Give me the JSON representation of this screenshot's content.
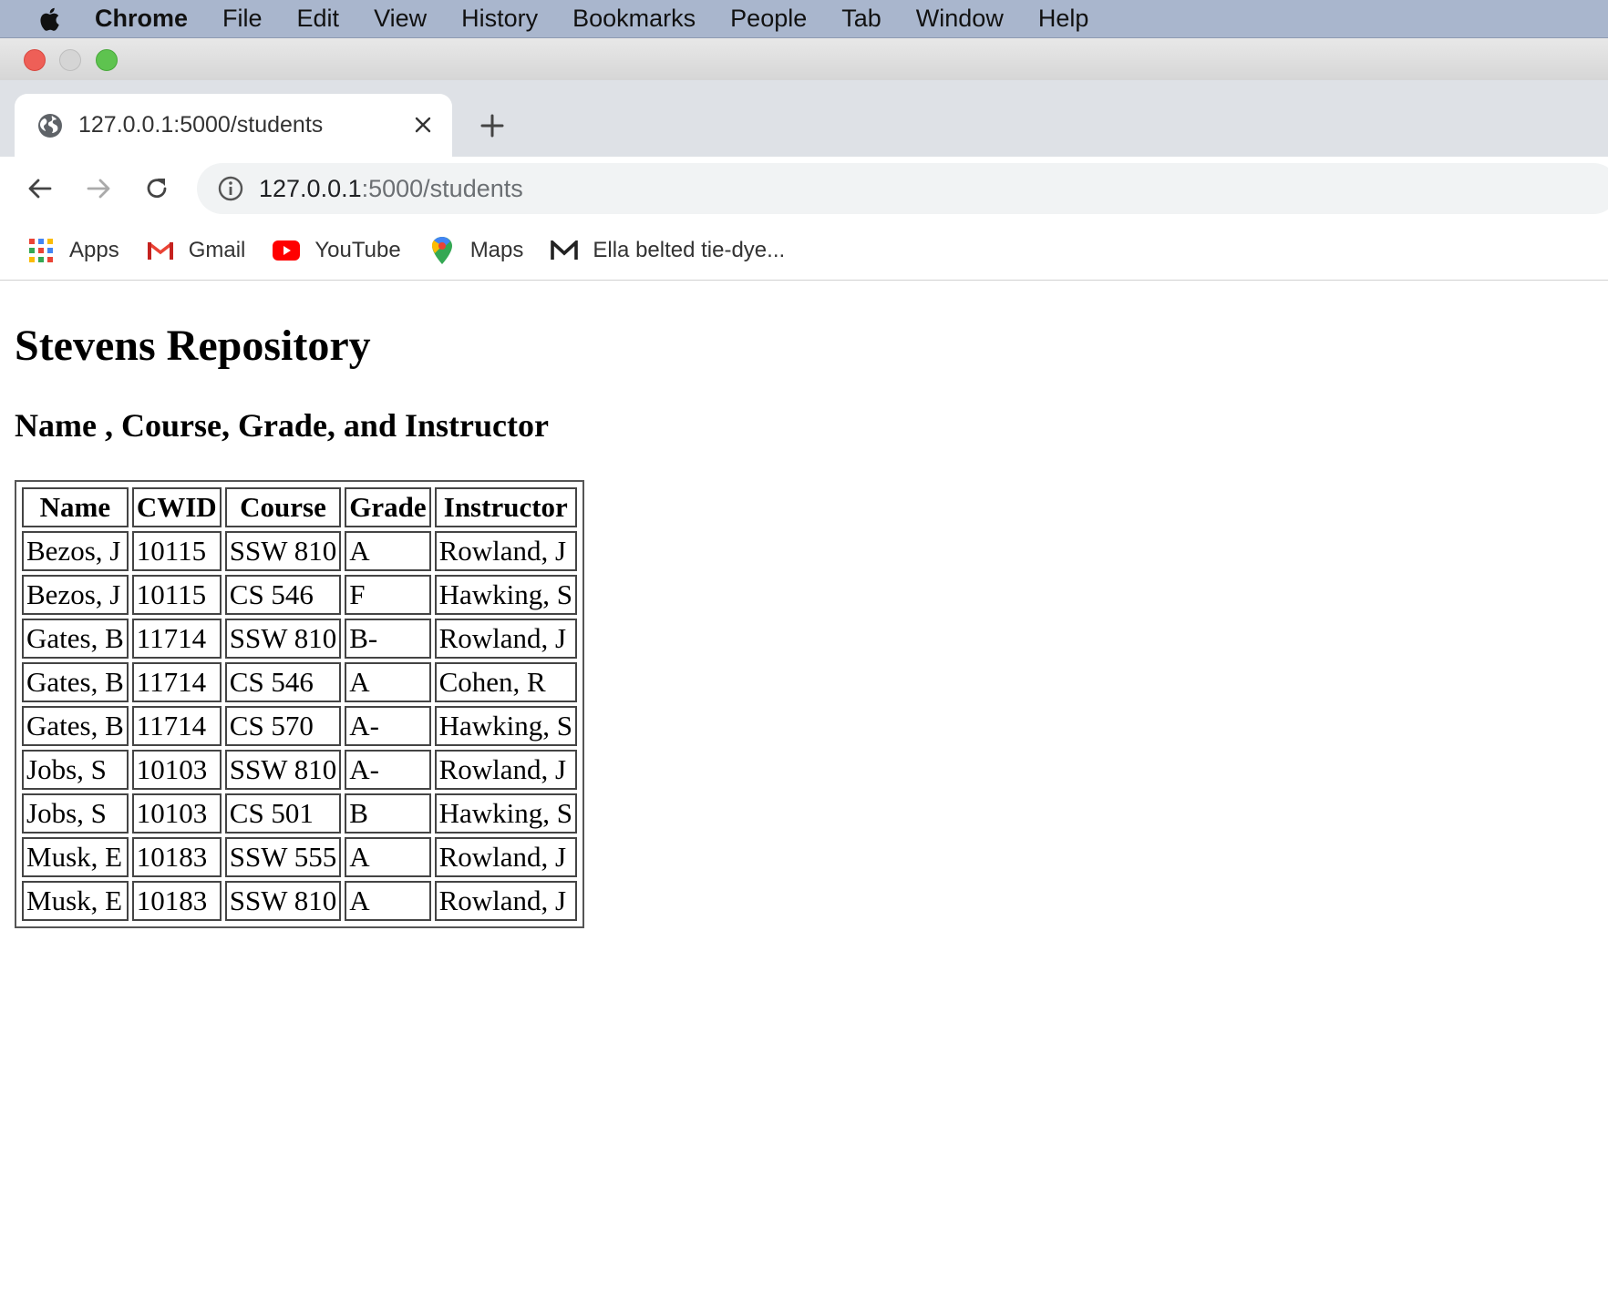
{
  "menubar": {
    "app_name": "Chrome",
    "items": [
      "File",
      "Edit",
      "View",
      "History",
      "Bookmarks",
      "People",
      "Tab",
      "Window",
      "Help"
    ]
  },
  "tab": {
    "title": "127.0.0.1:5000/students"
  },
  "omnibox": {
    "host": "127.0.0.1",
    "path": ":5000/students"
  },
  "bookmarks": [
    {
      "label": "Apps",
      "icon": "apps-grid-icon"
    },
    {
      "label": "Gmail",
      "icon": "gmail-icon"
    },
    {
      "label": "YouTube",
      "icon": "youtube-icon"
    },
    {
      "label": "Maps",
      "icon": "maps-pin-icon"
    },
    {
      "label": "Ella belted tie-dye...",
      "icon": "m-logo-icon"
    }
  ],
  "page": {
    "title": "Stevens Repository",
    "subtitle": "Name , Course, Grade, and Instructor",
    "table": {
      "headers": [
        "Name",
        "CWID",
        "Course",
        "Grade",
        "Instructor"
      ],
      "rows": [
        [
          "Bezos, J",
          "10115",
          "SSW 810",
          "A",
          "Rowland, J"
        ],
        [
          "Bezos, J",
          "10115",
          "CS 546",
          "F",
          "Hawking, S"
        ],
        [
          "Gates, B",
          "11714",
          "SSW 810",
          "B-",
          "Rowland, J"
        ],
        [
          "Gates, B",
          "11714",
          "CS 546",
          "A",
          "Cohen, R"
        ],
        [
          "Gates, B",
          "11714",
          "CS 570",
          "A-",
          "Hawking, S"
        ],
        [
          "Jobs, S",
          "10103",
          "SSW 810",
          "A-",
          "Rowland, J"
        ],
        [
          "Jobs, S",
          "10103",
          "CS 501",
          "B",
          "Hawking, S"
        ],
        [
          "Musk, E",
          "10183",
          "SSW 555",
          "A",
          "Rowland, J"
        ],
        [
          "Musk, E",
          "10183",
          "SSW 810",
          "A",
          "Rowland, J"
        ]
      ]
    }
  }
}
